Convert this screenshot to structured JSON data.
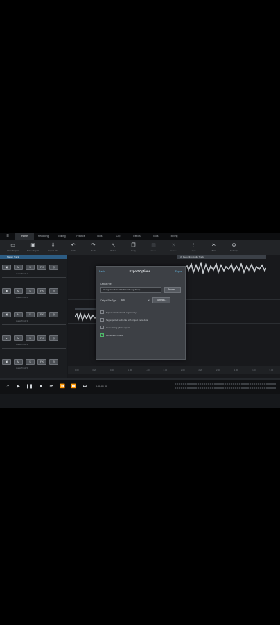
{
  "menu": {
    "tabs": [
      "Home",
      "Recording",
      "Editing",
      "Practice",
      "Tools",
      "Clip",
      "Effects",
      "Tools",
      "Mixing"
    ]
  },
  "toolbar": {
    "items": [
      {
        "label": "New Project",
        "icon": "file-plus-icon"
      },
      {
        "label": "Save Project",
        "icon": "save-icon"
      },
      {
        "label": "Import File",
        "icon": "import-icon"
      },
      {
        "label": "Undo",
        "icon": "undo-icon"
      },
      {
        "label": "Redo",
        "icon": "redo-icon"
      },
      {
        "label": "Select",
        "icon": "cursor-icon"
      },
      {
        "label": "Copy",
        "icon": "copy-icon"
      },
      {
        "label": "Paste",
        "icon": "paste-icon"
      },
      {
        "label": "Delete",
        "icon": "delete-icon"
      },
      {
        "label": "Split",
        "icon": "split-icon"
      },
      {
        "label": "Trim",
        "icon": "trim-icon"
      },
      {
        "label": "Settings",
        "icon": "gear-icon"
      }
    ]
  },
  "tracks": {
    "header": "Master Track",
    "names": [
      "Audio Track 1",
      "Audio Track 2",
      "Audio Track 3",
      "Audio Track 4",
      "Audio Track 5"
    ]
  },
  "clip": {
    "title": "My Recording Audio Track"
  },
  "ruler": [
    "0.00",
    "0.20",
    "0.40",
    "1.00",
    "1.20",
    "1.40",
    "2.00",
    "2.20",
    "2.40",
    "3.00",
    "3.20",
    "3.40"
  ],
  "transport": {
    "time": "0:00:01.00"
  },
  "dialog": {
    "back": "Back",
    "title": "Export Options",
    "export": "Export",
    "output_label": "Output File",
    "output_path": "/storage/emulated/0/n-Track/Songs/temp",
    "browse": "Browse...",
    "type_label": "Output File Type",
    "type_value": "wav",
    "settings": "Settings...",
    "options": [
      {
        "label": "Export selected track region only",
        "checked": false
      },
      {
        "label": "Tag exported audio file with project meta data",
        "checked": false
      },
      {
        "label": "Use existing photo export",
        "checked": false
      },
      {
        "label": "Remember choice",
        "checked": true
      }
    ]
  }
}
